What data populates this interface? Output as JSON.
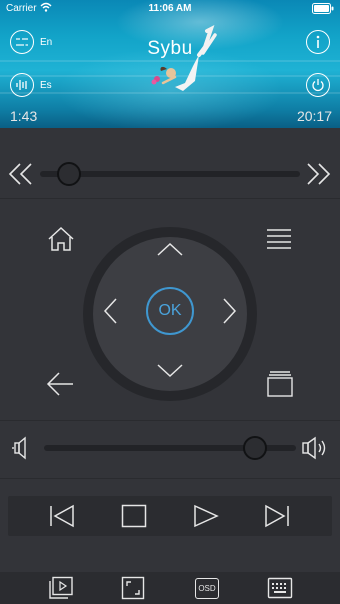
{
  "status_bar": {
    "carrier": "Carrier",
    "time": "11:06 AM"
  },
  "header": {
    "title": "Sybu",
    "subtitle_lang": "En",
    "audio_lang": "Es",
    "elapsed": "1:43",
    "end_time": "20:17"
  },
  "dpad": {
    "ok_label": "OK"
  },
  "bottom_bar": {
    "osd_label": "OSD"
  },
  "colors": {
    "background": "#333439",
    "accent": "#3f97d0",
    "hero_water": "#12a3c8"
  },
  "seek": {
    "position": 0.08
  },
  "volume": {
    "level": 0.85
  }
}
